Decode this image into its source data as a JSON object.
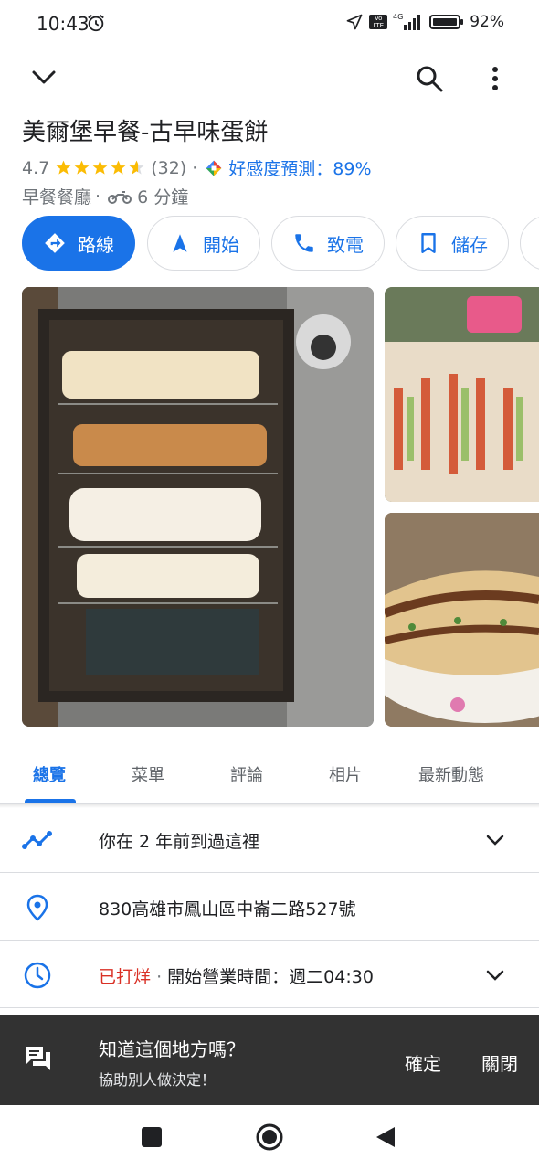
{
  "status": {
    "time": "10:43",
    "network": "4G",
    "volte": "Vo LTE",
    "battery": "92%"
  },
  "place": {
    "title": "美爾堡早餐-古早味蛋餅",
    "rating": "4.7",
    "stars": 4.7,
    "reviews": "(32)",
    "sep": "·",
    "prediction": "好感度預測：89%",
    "category": "早餐餐廳",
    "travel_time": "6 分鐘"
  },
  "actions": {
    "directions": "路線",
    "start": "開始",
    "call": "致電",
    "save": "儲存"
  },
  "tabs": [
    "總覽",
    "菜單",
    "評論",
    "相片",
    "最新動態"
  ],
  "info": {
    "visited": "你在 2 年前到過這裡",
    "address": "830高雄市鳳山區中崙二路527號",
    "closed": "已打烊",
    "hours": "開始營業時間：週二04:30"
  },
  "snackbar": {
    "title": "知道這個地方嗎？",
    "subtitle": "協助別人做決定！",
    "confirm": "確定",
    "close": "關閉"
  },
  "colors": {
    "accent": "#1a73e8",
    "closed": "#d93025",
    "star": "#fbbc04"
  }
}
